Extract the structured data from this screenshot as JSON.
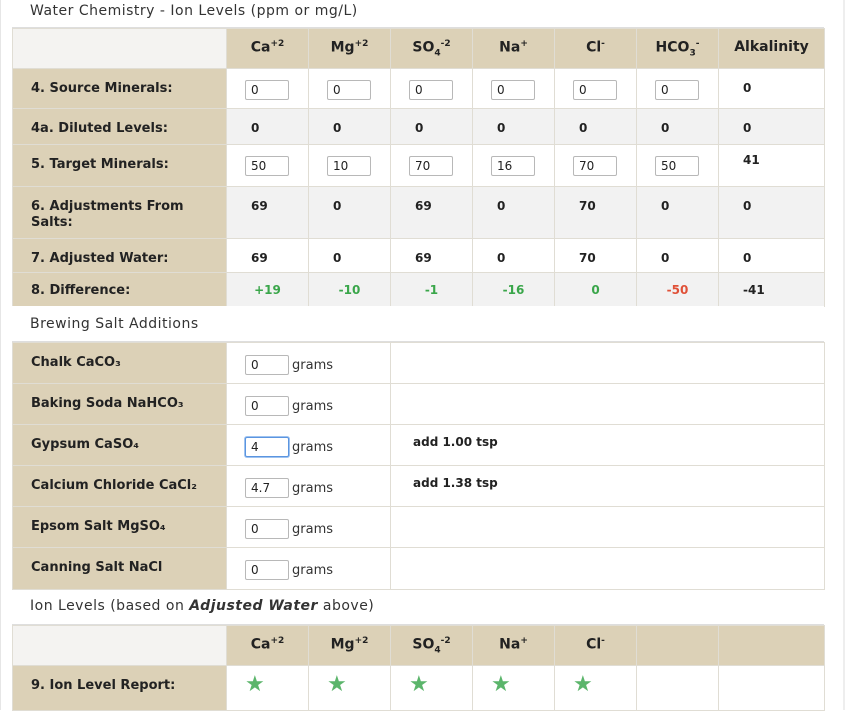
{
  "chemistry": {
    "title": "Water Chemistry - Ion Levels (ppm or mg/L)",
    "columns": [
      {
        "base": "Ca",
        "sup": "+2",
        "sub": ""
      },
      {
        "base": "Mg",
        "sup": "+2",
        "sub": ""
      },
      {
        "base": "SO",
        "sub": "4",
        "sup": "-2"
      },
      {
        "base": "Na",
        "sup": "+",
        "sub": ""
      },
      {
        "base": "Cl",
        "sup": "-",
        "sub": ""
      },
      {
        "base": "HCO",
        "sub": "3",
        "sup": "-"
      },
      {
        "base": "Alkalinity",
        "sup": "",
        "sub": ""
      }
    ],
    "rows": {
      "source": {
        "label": "4. Source Minerals:",
        "inputs": [
          "0",
          "0",
          "0",
          "0",
          "0",
          "0"
        ],
        "alkalinity": "0"
      },
      "diluted": {
        "label": "4a. Diluted Levels:",
        "values": [
          "0",
          "0",
          "0",
          "0",
          "0",
          "0",
          "0"
        ]
      },
      "target": {
        "label": "5. Target Minerals:",
        "inputs": [
          "50",
          "10",
          "70",
          "16",
          "70",
          "50"
        ],
        "alkalinity": "41"
      },
      "adjust": {
        "label": "6. Adjustments From Salts:",
        "values": [
          "69",
          "0",
          "69",
          "0",
          "70",
          "0",
          "0"
        ]
      },
      "adjusted": {
        "label": "7. Adjusted Water:",
        "values": [
          "69",
          "0",
          "69",
          "0",
          "70",
          "0",
          "0"
        ]
      },
      "difference": {
        "label": "8. Difference:",
        "values": [
          "+19",
          "-10",
          "-1",
          "-16",
          "0",
          "-50",
          "-41"
        ]
      }
    }
  },
  "salts": {
    "title": "Brewing Salt Additions",
    "unit": "grams",
    "items": [
      {
        "label": "Chalk CaCO₃",
        "value": "0",
        "note": ""
      },
      {
        "label": "Baking Soda NaHCO₃",
        "value": "0",
        "note": ""
      },
      {
        "label": "Gypsum CaSO₄",
        "value": "4",
        "note": "add 1.00 tsp"
      },
      {
        "label": "Calcium Chloride CaCl₂",
        "value": "4.7",
        "note": "add 1.38 tsp"
      },
      {
        "label": "Epsom Salt MgSO₄",
        "value": "0",
        "note": ""
      },
      {
        "label": "Canning Salt NaCl",
        "value": "0",
        "note": ""
      }
    ]
  },
  "ion_levels": {
    "title_prefix": "Ion Levels (based on ",
    "title_em": "Adjusted Water",
    "title_suffix": " above)",
    "report_label": "9. Ion Level Report:",
    "star_icon": "star-icon",
    "star_color": "#5bb56b"
  },
  "colors": {
    "label_bg": "#dcd1b7",
    "positive": "#3aa64a",
    "negative_red": "#e05138"
  }
}
